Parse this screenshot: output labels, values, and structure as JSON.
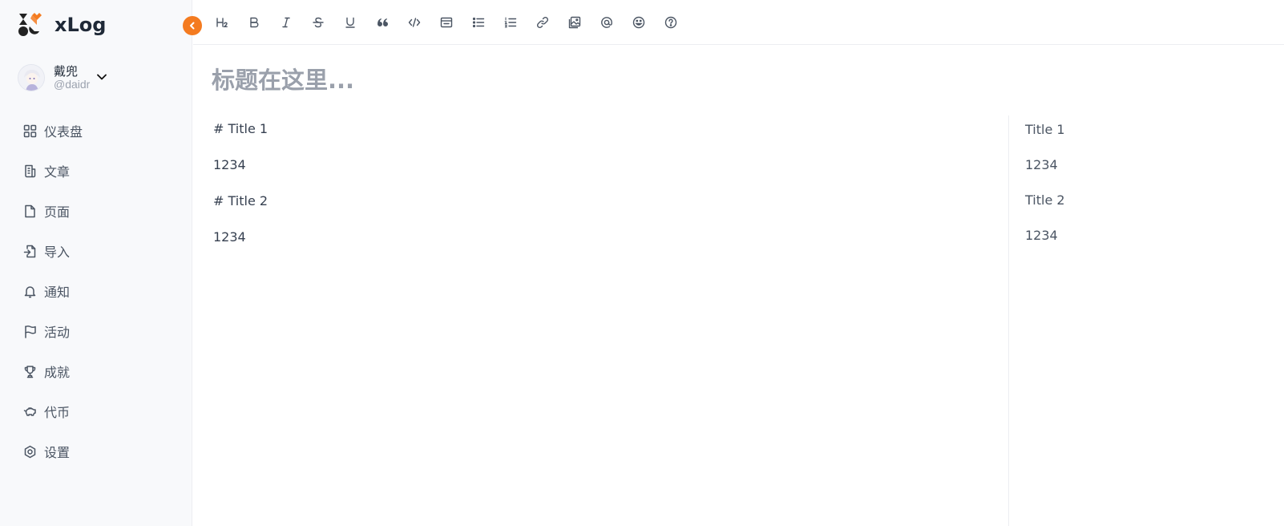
{
  "app": {
    "name": "xLog"
  },
  "colors": {
    "accent": "#f47b20",
    "sidebar_bg": "#f8f9fb",
    "icon": "#4b5563"
  },
  "user": {
    "display_name": "戴兜",
    "handle": "@daidr"
  },
  "nav": [
    {
      "label": "仪表盘",
      "icon": "dashboard-icon"
    },
    {
      "label": "文章",
      "icon": "article-icon"
    },
    {
      "label": "页面",
      "icon": "page-icon"
    },
    {
      "label": "导入",
      "icon": "import-icon"
    },
    {
      "label": "通知",
      "icon": "bell-icon"
    },
    {
      "label": "活动",
      "icon": "flag-icon"
    },
    {
      "label": "成就",
      "icon": "trophy-icon"
    },
    {
      "label": "代币",
      "icon": "piggy-bank-icon"
    },
    {
      "label": "设置",
      "icon": "settings-icon"
    }
  ],
  "toolbar": [
    "heading-icon",
    "bold-icon",
    "italic-icon",
    "strikethrough-icon",
    "underline-icon",
    "quote-icon",
    "code-icon",
    "code-block-icon",
    "unordered-list-icon",
    "ordered-list-icon",
    "link-icon",
    "image-icon",
    "mention-icon",
    "emoji-icon",
    "help-icon"
  ],
  "editor": {
    "title_placeholder": "标题在这里...",
    "source_lines": [
      "# Title 1",
      "1234",
      "# Title 2",
      "1234"
    ],
    "preview_lines": [
      "Title 1",
      "1234",
      "Title 2",
      "1234"
    ]
  }
}
